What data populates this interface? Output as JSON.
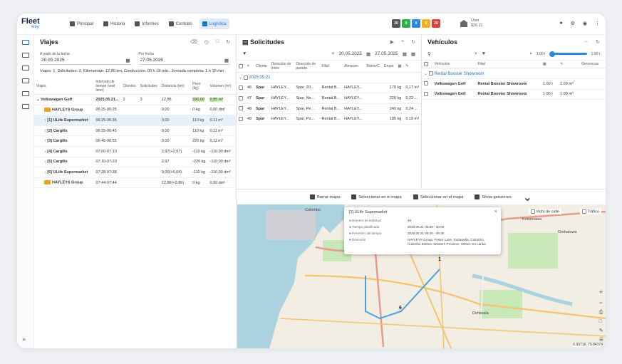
{
  "app": {
    "logo_top": "Fleet",
    "logo_bottom": "way"
  },
  "nav": [
    {
      "label": "Principal",
      "active": false
    },
    {
      "label": "Historia",
      "active": false
    },
    {
      "label": "Informes",
      "active": false
    },
    {
      "label": "Contrato",
      "active": false
    },
    {
      "label": "Logística",
      "active": true
    }
  ],
  "badges": [
    {
      "value": "20",
      "color": "#555555"
    },
    {
      "value": "0",
      "color": "#2fb14a"
    },
    {
      "value": "0",
      "color": "#2b8be0"
    },
    {
      "value": "0",
      "color": "#f0b222"
    },
    {
      "value": "20",
      "color": "#e0403a"
    }
  ],
  "user": {
    "name": "User",
    "balance": "$26.11"
  },
  "viajes": {
    "title": "Viajes",
    "from_label": "A partir de la fecha",
    "from_value": "20.05.2025",
    "to_label": "Por fecha",
    "to_value": "27.05.2025",
    "summary": "Viajes: 1, Solicitudes: 3, Kilometraje: 12,80 km, Conducción: 00 h 18 min., Jornada completa: 1 h 18 min.",
    "columns": [
      "Viajes",
      "Intervalo de tiempo (wait time)",
      "Clientes",
      "Solicitudes",
      "Distancia (km)",
      "Peso (kg)",
      "Volumen (m³)"
    ],
    "vehicle_row": {
      "name": "Volkswagen Golf",
      "interval": "2025.05.21...",
      "clients": "2",
      "requests": "3",
      "distance": "12,86",
      "weight": "330,00",
      "volume": "0,85 m³"
    },
    "rows": [
      {
        "icon": "truck",
        "name": "HAYLEYS Group",
        "interval": "06:25-06:25",
        "distance": "0,00",
        "weight": "0 kg",
        "volume": "0,00 dm³"
      },
      {
        "icon": "up",
        "name": "[1] ULife Supermarket",
        "interval": "06:25-06:35",
        "distance": "0,00",
        "weight": "110 kg",
        "volume": "0,11 m³",
        "selected": true
      },
      {
        "icon": "up",
        "name": "[2] Cargills",
        "interval": "06:35-06:45",
        "distance": "0,00",
        "weight": "110 kg",
        "volume": "0,11 m³"
      },
      {
        "icon": "up",
        "name": "[3] Cargills",
        "interval": "06:45-06:55",
        "distance": "0,00",
        "weight": "220 kg",
        "volume": "0,11 m³"
      },
      {
        "icon": "down",
        "name": "[4] Cargills",
        "interval": "07:00-07:10",
        "distance": "2,97(+2,97)",
        "weight": "-110 kg",
        "volume": "-110,00 dm³"
      },
      {
        "icon": "down",
        "name": "[5] Cargills",
        "interval": "07:10-07:20",
        "distance": "2,97",
        "weight": "-220 kg",
        "volume": "-110,00 dm³"
      },
      {
        "icon": "down",
        "name": "[6] ULife Supermarket",
        "interval": "07:28-07:38",
        "distance": "9,00(+6,04)",
        "weight": "-110 kg",
        "volume": "-110,00 dm³"
      },
      {
        "icon": "truck",
        "name": "HAYLEYS Group",
        "interval": "07:44-07:44",
        "distance": "12,86(+3,86)",
        "weight": "0 kg",
        "volume": "0,00 dm³"
      }
    ]
  },
  "solicitudes": {
    "title": "Solicitudes",
    "from_value": "20.05.2025",
    "to_value": "27.05.2025",
    "columns": [
      "#",
      "Cliente",
      "Dirección de inicio",
      "Dirección de parada",
      "Filial",
      "Almacén",
      "Barrio/C",
      "Grupo"
    ],
    "group": "2025.05.21",
    "rows": [
      {
        "id": "46",
        "client": "Spar",
        "start": "HAYLEY...",
        "stop": "Spar, 20...",
        "filial": "Rental B...",
        "store": "HAYLEY...",
        "weight": "170 kg",
        "volume": "0,17 m³"
      },
      {
        "id": "47",
        "client": "Spar",
        "start": "HAYLEY...",
        "stop": "Spar, Ne...",
        "filial": "Rental B...",
        "store": "HAYLEY...",
        "weight": "220 kg",
        "volume": "0,22 ..."
      },
      {
        "id": "48",
        "client": "Spar",
        "start": "HAYLEY...",
        "stop": "Spar, Pe...",
        "filial": "Rental B...",
        "store": "HAYLEY...",
        "weight": "240 kg",
        "volume": "0,24 ..."
      },
      {
        "id": "49",
        "client": "Spar",
        "start": "HAYLEY...",
        "stop": "Spar, Po...",
        "filial": "Rental B...",
        "store": "HAYLEY...",
        "weight": "185 kg",
        "volume": "0,19 m³"
      }
    ]
  },
  "vehiculos": {
    "title": "Vehículos",
    "range_min": "1.00 t",
    "range_max": "1.00 t",
    "columns": [
      "Vehículos",
      "Filial",
      "Geocercas"
    ],
    "group": "Rental Booster Showroom",
    "rows": [
      {
        "name": "Volkswagen Golf",
        "filial": "Rental Booster Showroom",
        "weight": "1.00 t",
        "volume": "1.00 m³"
      },
      {
        "name": "Volkswagen Golf",
        "filial": "Rental Booster Showroom",
        "weight": "1.00 t",
        "volume": "1.00 m³"
      }
    ]
  },
  "map_tools": [
    "Borrar mapa",
    "Seleccionar en el mapa",
    "Seleccionar en el mapa",
    "Show geozones"
  ],
  "map": {
    "chk_streetview": "Vista de calle",
    "chk_traffic": "Tráfico",
    "coords": "6.93716, 79.84374",
    "labels": [
      "Colombo",
      "Kolonnawa",
      "Gothatuwa",
      "Dehiwala"
    ],
    "markers": [
      "1",
      "6"
    ],
    "popup": {
      "title": "[1] ULife Supermarket",
      "rows": [
        {
          "k": "Número de solicitud",
          "v": "46"
        },
        {
          "k": "Tiempo planificado",
          "v": "2025.05.21 05:00 - 20:00"
        },
        {
          "k": "Previsión del tiempo",
          "v": "2025.05.21 06:25 - 06:35"
        },
        {
          "k": "Dirección",
          "v": "HAYLEYS Group, Foster Lane, Suduwella, Colombo, Colombo District, Western Province, 00010, Sri Lanka"
        }
      ]
    }
  }
}
